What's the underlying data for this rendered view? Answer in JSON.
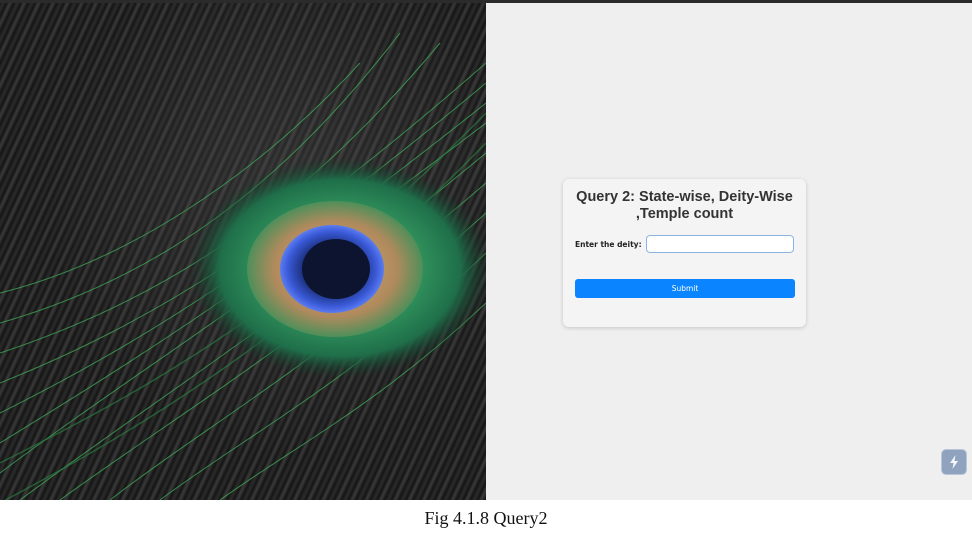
{
  "query_card": {
    "title": "Query 2: State-wise, Deity-Wise ,Temple count",
    "deity_label": "Enter the deity:",
    "deity_value": "",
    "submit_label": "Submit"
  },
  "background_image": {
    "subject": "peacock-feather"
  },
  "floating_button": {
    "icon": "lightning-bolt-icon"
  },
  "figure": {
    "caption": "Fig 4.1.8 Query2"
  },
  "colors": {
    "accent": "#0a84ff",
    "page_background": "#efefef",
    "card_background": "#f4f4f4"
  }
}
